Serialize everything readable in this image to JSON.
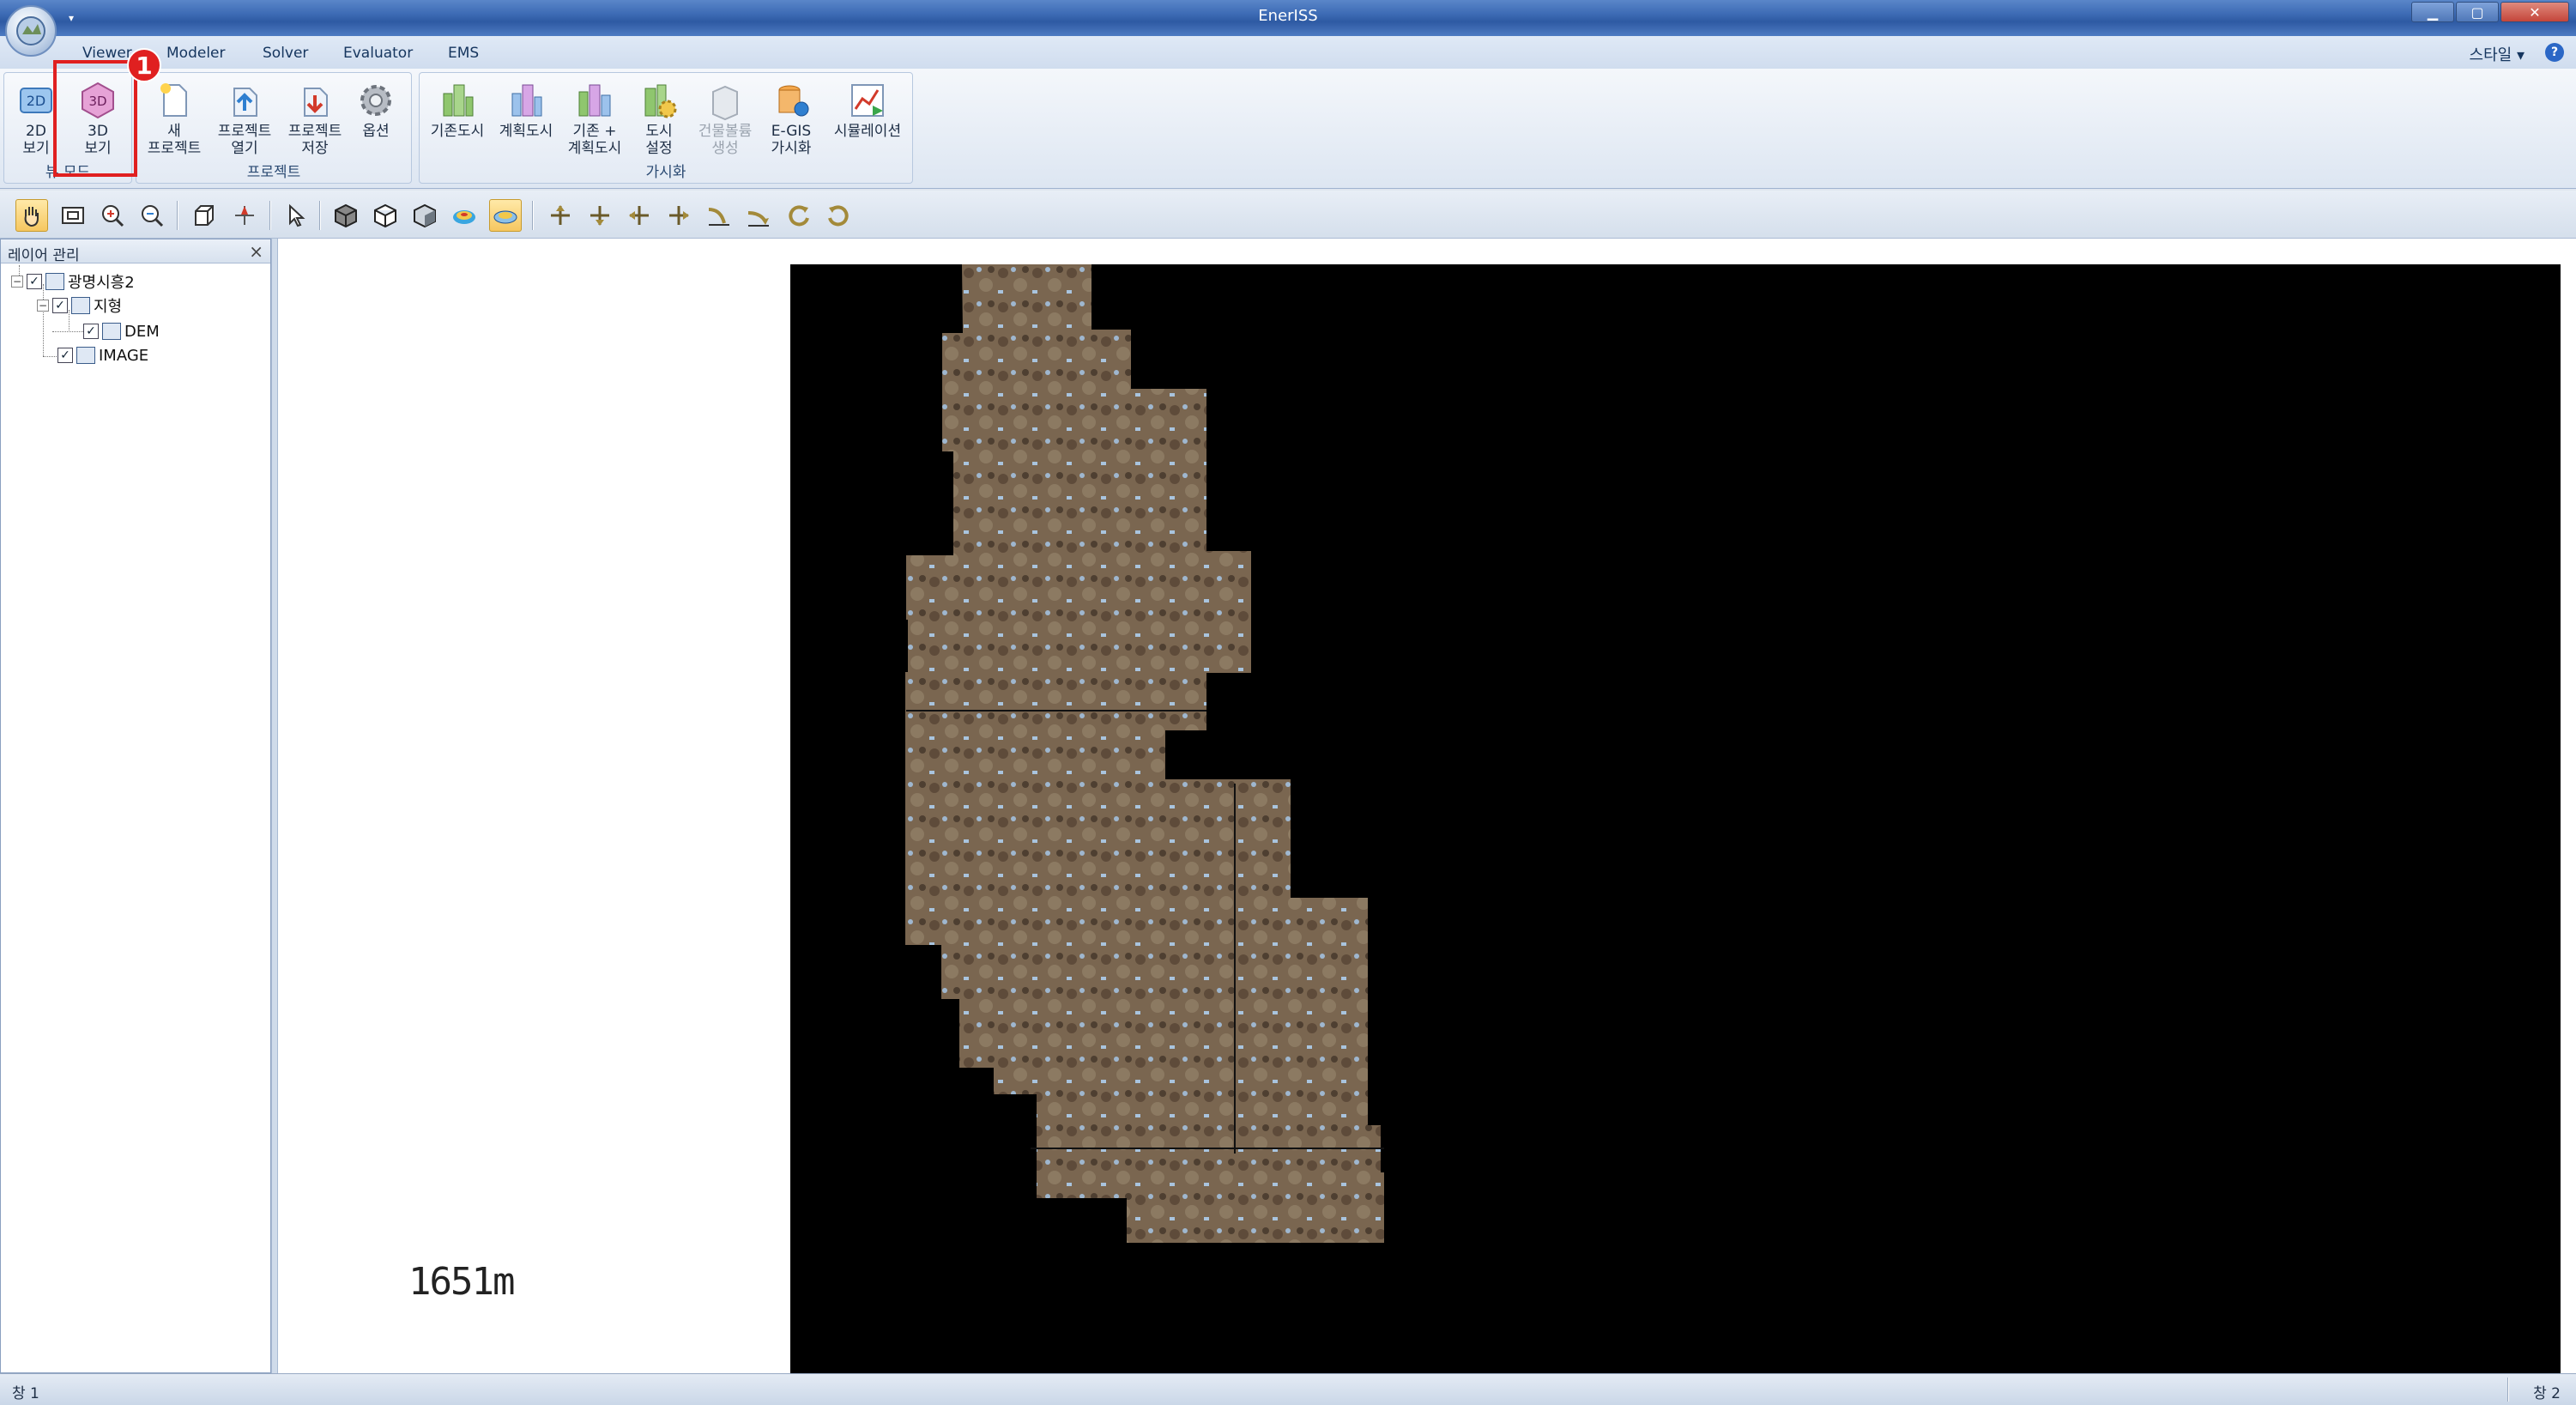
{
  "window": {
    "title": "EnerISS"
  },
  "tabs": [
    {
      "label": "Viewer"
    },
    {
      "label": "Modeler"
    },
    {
      "label": "Solver"
    },
    {
      "label": "Evaluator"
    },
    {
      "label": "EMS"
    }
  ],
  "style_menu": {
    "label": "스타일",
    "chevron": "chevron-down-icon"
  },
  "help": {
    "label": "?"
  },
  "ribbon": {
    "groups": [
      {
        "label": "뷰 모드",
        "buttons": [
          {
            "label": "2D\n보기",
            "icon": "2d-view-icon"
          },
          {
            "label": "3D\n보기",
            "icon": "3d-view-icon"
          }
        ]
      },
      {
        "label": "프로젝트",
        "buttons": [
          {
            "label": "새\n프로젝트",
            "icon": "new-project-icon"
          },
          {
            "label": "프로젝트\n열기",
            "icon": "open-project-icon"
          },
          {
            "label": "프로젝트\n저장",
            "icon": "save-project-icon"
          },
          {
            "label": "옵션",
            "icon": "gear-icon"
          }
        ]
      },
      {
        "label": "가시화",
        "buttons": [
          {
            "label": "기존도시",
            "icon": "existing-city-icon"
          },
          {
            "label": "계획도시",
            "icon": "planned-city-icon"
          },
          {
            "label": "기존 +\n계획도시",
            "icon": "existing-planned-city-icon"
          },
          {
            "label": "도시\n설정",
            "icon": "city-settings-icon"
          },
          {
            "label": "건물볼륨\n생성",
            "icon": "building-volume-icon",
            "disabled": true
          },
          {
            "label": "E-GIS\n가시화",
            "icon": "egis-icon"
          },
          {
            "label": "시뮬레이션",
            "icon": "simulation-icon"
          }
        ]
      }
    ],
    "annotation_badge": "1"
  },
  "toolbar": {
    "tools": [
      "hand-pan-icon",
      "fit-extent-icon",
      "zoom-in-icon",
      "zoom-out-icon",
      "box-view-icon",
      "north-arrow-icon",
      "select-pointer-icon",
      "solid-cube-icon",
      "wire-cube-icon",
      "shaded-cube-icon",
      "terrain-color-icon",
      "terrain-flat-icon",
      "move-forward-icon",
      "move-back-icon",
      "move-left-icon",
      "move-right-icon",
      "tilt-up-icon",
      "tilt-down-icon",
      "rotate-left-icon",
      "rotate-right-icon"
    ]
  },
  "layer_panel": {
    "title": "레이어 관리",
    "tree": [
      {
        "label": "광명시흥2",
        "level": 0,
        "checked": true,
        "expanded": true
      },
      {
        "label": "지형",
        "level": 1,
        "checked": true,
        "expanded": true
      },
      {
        "label": "DEM",
        "level": 2,
        "checked": true
      },
      {
        "label": "IMAGE",
        "level": 1,
        "checked": true
      }
    ]
  },
  "viewport": {
    "scale_text": "1651m"
  },
  "status": {
    "left": "창 1",
    "right": "창 2"
  },
  "colors": {
    "accent": "#3c6ab4",
    "highlight": "#e02020",
    "map_bg": "#000000"
  }
}
